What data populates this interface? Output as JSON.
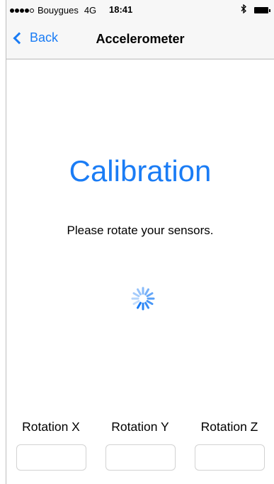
{
  "status_bar": {
    "carrier": "Bouygues",
    "network": "4G",
    "time": "18:41",
    "signal_strength": 4,
    "signal_max": 5,
    "bluetooth_icon": "bluetooth-icon",
    "battery_icon": "battery-icon"
  },
  "nav": {
    "back_label": "Back",
    "title": "Accelerometer",
    "accent": "#1a7cf5"
  },
  "main": {
    "title": "Calibration",
    "instruction": "Please rotate your sensors.",
    "spinner_icon": "activity-spinner-icon"
  },
  "rotation": {
    "labels": [
      "Rotation X",
      "Rotation Y",
      "Rotation Z"
    ],
    "values": [
      "",
      "",
      ""
    ]
  }
}
